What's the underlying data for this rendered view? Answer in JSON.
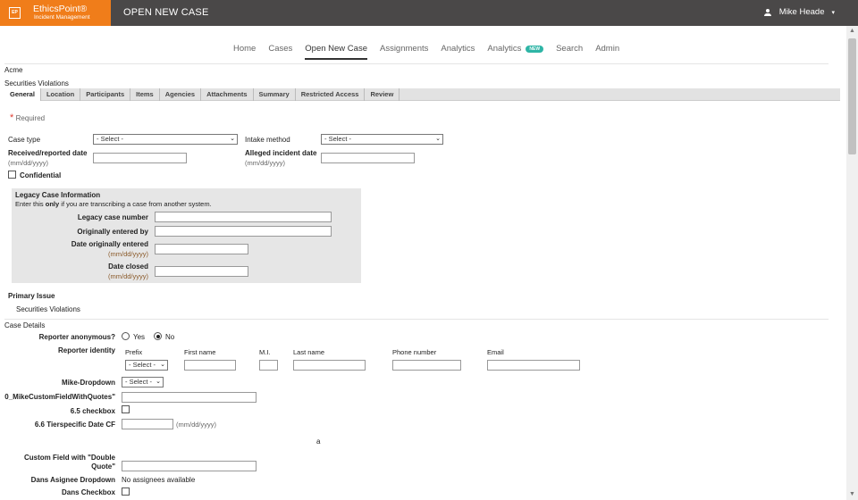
{
  "header": {
    "logo_badge": "EP",
    "logo_name": "EthicsPoint®",
    "logo_sub": "Incident Management",
    "page_heading": "OPEN NEW CASE",
    "user_name": "Mike Heade",
    "user_caret": "▾"
  },
  "nav": {
    "items": [
      {
        "label": "Home"
      },
      {
        "label": "Cases"
      },
      {
        "label": "Open New Case",
        "active": true
      },
      {
        "label": "Assignments"
      },
      {
        "label": "Analytics"
      },
      {
        "label": "Analytics",
        "badge": "NEW"
      },
      {
        "label": "Search"
      },
      {
        "label": "Admin"
      }
    ]
  },
  "context": {
    "company": "Acme",
    "category": "Securities Violations"
  },
  "tabs": [
    "General",
    "Location",
    "Participants",
    "Items",
    "Agencies",
    "Attachments",
    "Summary",
    "Restricted Access",
    "Review"
  ],
  "form": {
    "required_star": "*",
    "required_label": "Required",
    "case_type_label": "Case type",
    "case_type_value": "- Select -",
    "intake_method_label": "Intake method",
    "intake_method_value": "- Select -",
    "received_date_label": "Received/reported date",
    "date_hint": "(mm/dd/yyyy)",
    "alleged_date_label": "Alleged incident date",
    "confidential_label": "Confidential"
  },
  "legacy": {
    "title": "Legacy Case Information",
    "note_before": "Enter this ",
    "note_bold": "only",
    "note_after": " if you are transcribing a case from another system.",
    "case_number_label": "Legacy case number",
    "entered_by_label": "Originally entered by",
    "date_entered_label": "Date originally entered",
    "date_closed_label": "Date closed"
  },
  "primary_issue": {
    "label": "Primary Issue",
    "value": "Securities Violations"
  },
  "case_details": {
    "title": "Case Details",
    "reporter_anon_label": "Reporter anonymous?",
    "yes": "Yes",
    "no": "No",
    "reporter_identity_label": "Reporter identity",
    "prefix_label": "Prefix",
    "prefix_value": "- Select -",
    "first_name_label": "First name",
    "mi_label": "M.I.",
    "last_name_label": "Last name",
    "phone_label": "Phone number",
    "email_label": "Email",
    "mike_dropdown_label": "Mike-Dropdown",
    "mike_dropdown_value": "- Select -",
    "custom_quotes_label": "0_MikeCustomFieldWithQuotes\"",
    "checkbox_65_label": "6.5 checkbox",
    "date_66_label": "6.6 Tierspecific Date CF",
    "date_66_hint": "(mm/dd/yyyy)",
    "stray_text": "a",
    "double_quote_label_1": "Custom Field with \"Double",
    "double_quote_label_2": "Quote\"",
    "dans_assignee_label": "Dans Asignee Dropdown",
    "dans_assignee_value": "No assignees available",
    "dans_checkbox_label": "Dans Checkbox"
  },
  "scrollbar": {
    "up": "▲",
    "down": "▼"
  }
}
